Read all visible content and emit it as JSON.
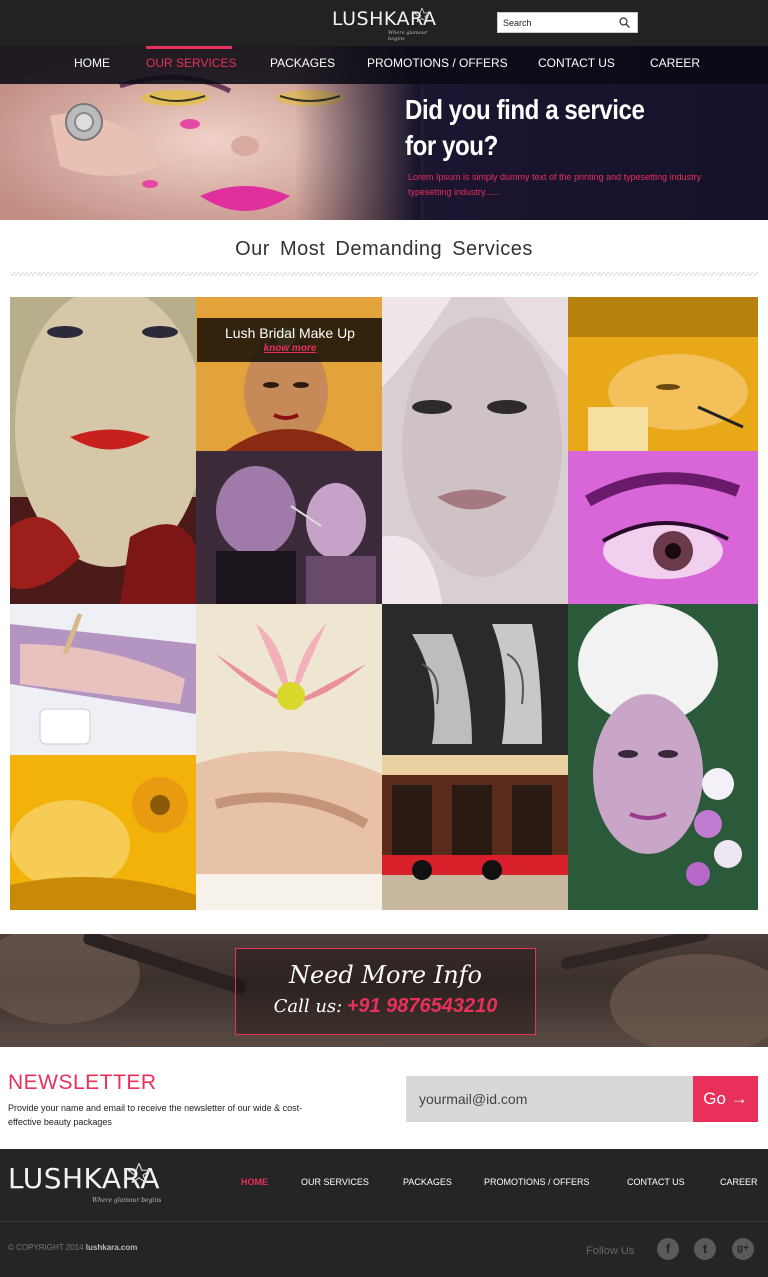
{
  "brand": {
    "name": "LUSHKARA",
    "tagline": "Where glamour begins"
  },
  "search": {
    "placeholder": "Search"
  },
  "nav": {
    "items": [
      "HOME",
      "OUR SERVICES",
      "PACKAGES",
      "PROMOTIONS / OFFERS",
      "CONTACT US",
      "CAREER"
    ],
    "active": "OUR SERVICES"
  },
  "hero": {
    "headline_line1": "Did you find a service",
    "headline_line2": "for you?",
    "text": "Lorem Ipsum is simply dummy text of the printing and typesetting industry typesetting industry......"
  },
  "services": {
    "title": "Our Most Demanding Services",
    "featured_caption": "Lush Bridal Make Up",
    "featured_link": "know more"
  },
  "info": {
    "title": "Need More Info",
    "call_label": "Call us:",
    "phone": "+91 9876543210"
  },
  "newsletter": {
    "title": "NEWSLETTER",
    "text": "Provide your name and email to receive the newsletter of our wide & cost-effective beauty packages",
    "email_placeholder": "yourmail@id.com",
    "go_label": "Go →"
  },
  "footer": {
    "nav": [
      "HOME",
      "OUR SERVICES",
      "PACKAGES",
      "PROMOTIONS / OFFERS",
      "CONTACT US",
      "CAREER"
    ],
    "active": "HOME",
    "copyright": "© COPYRIGHT 2014",
    "site": "lushkara.com",
    "follow": "Follow Us",
    "social_icons": [
      "facebook-icon",
      "twitter-icon",
      "google-plus-icon"
    ]
  },
  "colors": {
    "accent": "#e8305a",
    "topbar": "#222222",
    "footer": "#252525"
  }
}
